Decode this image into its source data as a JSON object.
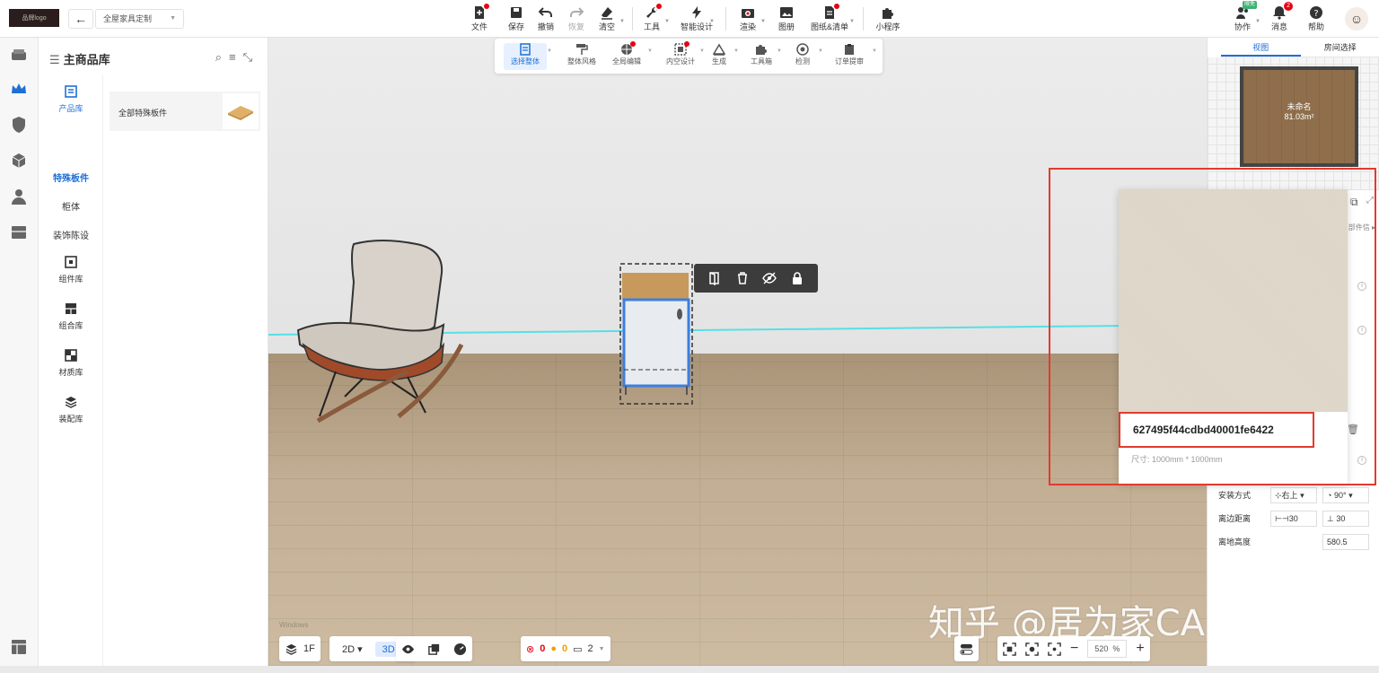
{
  "app": {
    "logo_text": "品牌logo",
    "project_name": "全屋家具定制"
  },
  "toolbar": {
    "file": "文件",
    "save": "保存",
    "undo": "撤销",
    "redo": "恢复",
    "clear": "清空",
    "tools": "工具",
    "smart_design": "智能设计",
    "render": "渲染",
    "gallery": "图册",
    "drawings": "图纸&清单",
    "mini_program": "小程序",
    "collaborate": "协作",
    "collaborate_badge": "限免",
    "messages": "消息",
    "messages_count": "2",
    "help": "帮助"
  },
  "context_toolbar": {
    "select_whole": "选择整体",
    "overall_style": "整体风格",
    "global_edit": "全局编辑",
    "interior_design": "内空设计",
    "generate": "生成",
    "toolbox": "工具箱",
    "check": "检测",
    "order": "订单提审"
  },
  "library": {
    "title": "主商品库",
    "categories": {
      "product_lib": "产品库",
      "special_board": "特殊板件",
      "cabinet": "柜体",
      "decor": "装饰陈设",
      "component_lib": "组件库",
      "combo_lib": "组合库",
      "material_lib": "材质库",
      "assembly_lib": "装配库"
    },
    "items": [
      {
        "label": "全部特殊板件"
      }
    ]
  },
  "right_panel": {
    "tab_view": "视图",
    "tab_room": "房间选择",
    "room_name": "未命名",
    "room_area": "81.03m²",
    "partial_label": "部件信",
    "install_label": "安装方式",
    "install_value": "右上",
    "angle_value": "90°",
    "edge_label": "离边距离",
    "edge_x": "30",
    "edge_y": "30",
    "height_label": "离地高度",
    "height_value": "580.5"
  },
  "tooltip": {
    "material_code": "627495f44cdbd40001fe6422",
    "size_text": "尺寸: 1000mm * 1000mm"
  },
  "bottom_bar": {
    "floor": "1F",
    "mode_2d": "2D",
    "mode_3d": "3D",
    "errors": "0",
    "warnings": "0",
    "items": "2",
    "zoom": "520",
    "zoom_unit": "%"
  },
  "watermark": {
    "text": "知乎 @居为家CAD培训",
    "small": "Windows"
  },
  "colors": {
    "accent": "#1f6fd6",
    "highlight": "#e23a2e",
    "cyan_guide": "#56e0e6"
  }
}
